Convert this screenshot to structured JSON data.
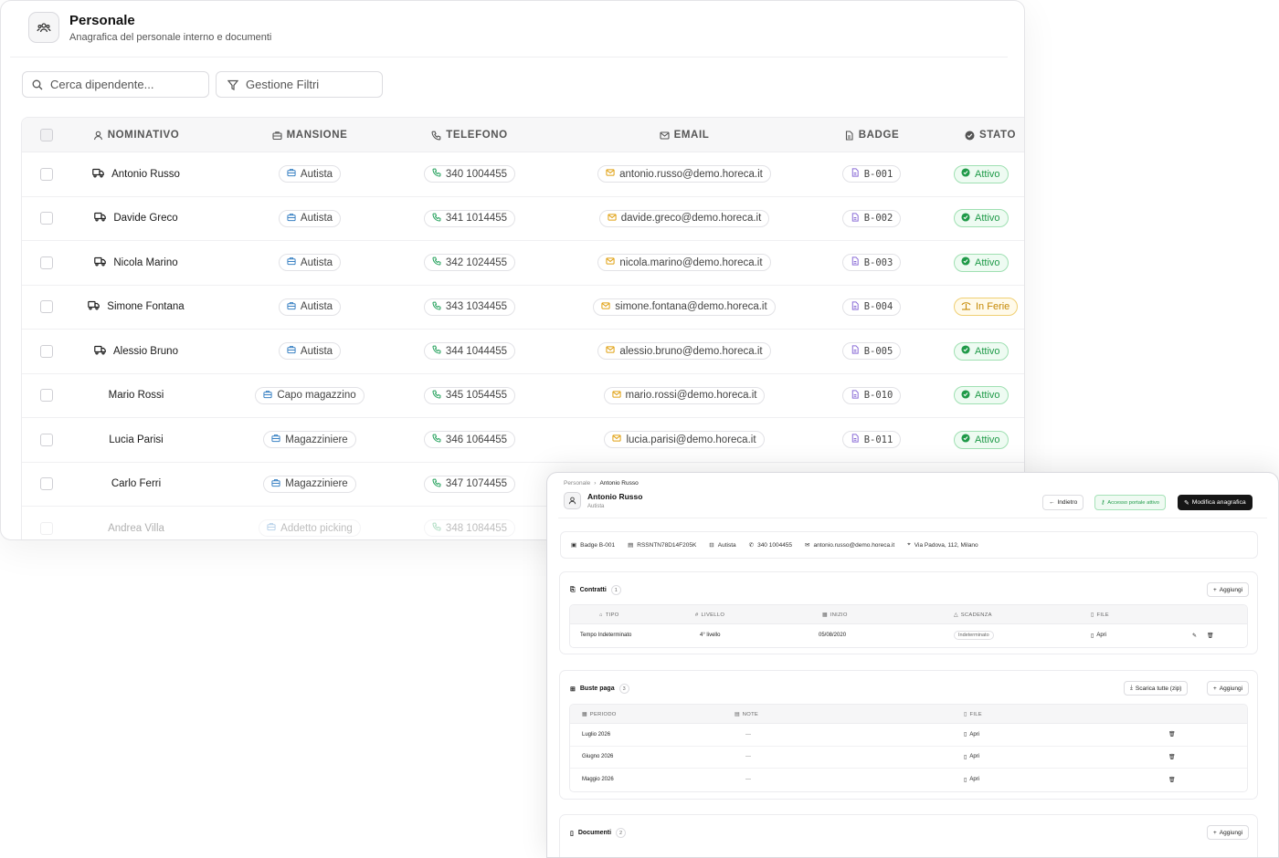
{
  "personale": {
    "title": "Personale",
    "subtitle": "Anagrafica del personale interno e documenti",
    "search_placeholder": "Cerca dipendente...",
    "filter_label": "Gestione Filtri",
    "columns": [
      "NOMINATIVO",
      "MANSIONE",
      "TELEFONO",
      "EMAIL",
      "BADGE",
      "STATO"
    ],
    "rows": [
      {
        "name": "Antonio Russo",
        "driver": true,
        "role": "Autista",
        "phone": "340 1004455",
        "email": "antonio.russo@demo.horeca.it",
        "badge": "B-001",
        "status": "Attivo"
      },
      {
        "name": "Davide Greco",
        "driver": true,
        "role": "Autista",
        "phone": "341 1014455",
        "email": "davide.greco@demo.horeca.it",
        "badge": "B-002",
        "status": "Attivo"
      },
      {
        "name": "Nicola Marino",
        "driver": true,
        "role": "Autista",
        "phone": "342 1024455",
        "email": "nicola.marino@demo.horeca.it",
        "badge": "B-003",
        "status": "Attivo"
      },
      {
        "name": "Simone Fontana",
        "driver": true,
        "role": "Autista",
        "phone": "343 1034455",
        "email": "simone.fontana@demo.horeca.it",
        "badge": "B-004",
        "status": "In Ferie"
      },
      {
        "name": "Alessio Bruno",
        "driver": true,
        "role": "Autista",
        "phone": "344 1044455",
        "email": "alessio.bruno@demo.horeca.it",
        "badge": "B-005",
        "status": "Attivo"
      },
      {
        "name": "Mario Rossi",
        "driver": false,
        "role": "Capo magazzino",
        "phone": "345 1054455",
        "email": "mario.rossi@demo.horeca.it",
        "badge": "B-010",
        "status": "Attivo"
      },
      {
        "name": "Lucia Parisi",
        "driver": false,
        "role": "Magazziniere",
        "phone": "346 1064455",
        "email": "lucia.parisi@demo.horeca.it",
        "badge": "B-011",
        "status": "Attivo"
      },
      {
        "name": "Carlo Ferri",
        "driver": false,
        "role": "Magazziniere",
        "phone": "347 1074455",
        "email": "",
        "badge": "",
        "status": ""
      },
      {
        "name": "Andrea Villa",
        "driver": false,
        "role": "Addetto picking",
        "phone": "348 1084455",
        "email": "",
        "badge": "",
        "status": ""
      }
    ]
  },
  "detail": {
    "breadcrumb": [
      "Personale",
      "Antonio Russo"
    ],
    "name": "Antonio Russo",
    "role": "Autista",
    "back_label": "Indietro",
    "portal_label": "Accesso portale attivo",
    "edit_label": "Modifica anagrafica",
    "info": {
      "badge": "Badge B-001",
      "fiscal_code": "RSSNTN78D14F205K",
      "role": "Autista",
      "phone": "340 1004455",
      "email": "antonio.russo@demo.horeca.it",
      "address": "Via Padova, 112, Milano"
    },
    "contratti": {
      "title": "Contratti",
      "count": "1",
      "add_label": "Aggiungi",
      "columns": [
        "TIPO",
        "LIVELLO",
        "INIZIO",
        "SCADENZA",
        "FILE"
      ],
      "rows": [
        {
          "tipo": "Tempo Indeterminato",
          "livello": "4° livello",
          "inizio": "05/08/2020",
          "scadenza": "Indeterminato",
          "file": "Apri"
        }
      ]
    },
    "buste": {
      "title": "Buste paga",
      "count": "3",
      "download_label": "Scarica tutte (zip)",
      "add_label": "Aggiungi",
      "columns": [
        "PERIODO",
        "NOTE",
        "FILE"
      ],
      "rows": [
        {
          "periodo": "Luglio 2026",
          "note": "—",
          "file": "Apri"
        },
        {
          "periodo": "Giugno 2026",
          "note": "—",
          "file": "Apri"
        },
        {
          "periodo": "Maggio 2026",
          "note": "—",
          "file": "Apri"
        }
      ]
    },
    "documenti": {
      "title": "Documenti",
      "count": "2",
      "add_label": "Aggiungi"
    }
  },
  "colors": {
    "accent_green": "#1f9a48",
    "status_ferie": "#c68a06",
    "primary_dark": "#161616"
  }
}
